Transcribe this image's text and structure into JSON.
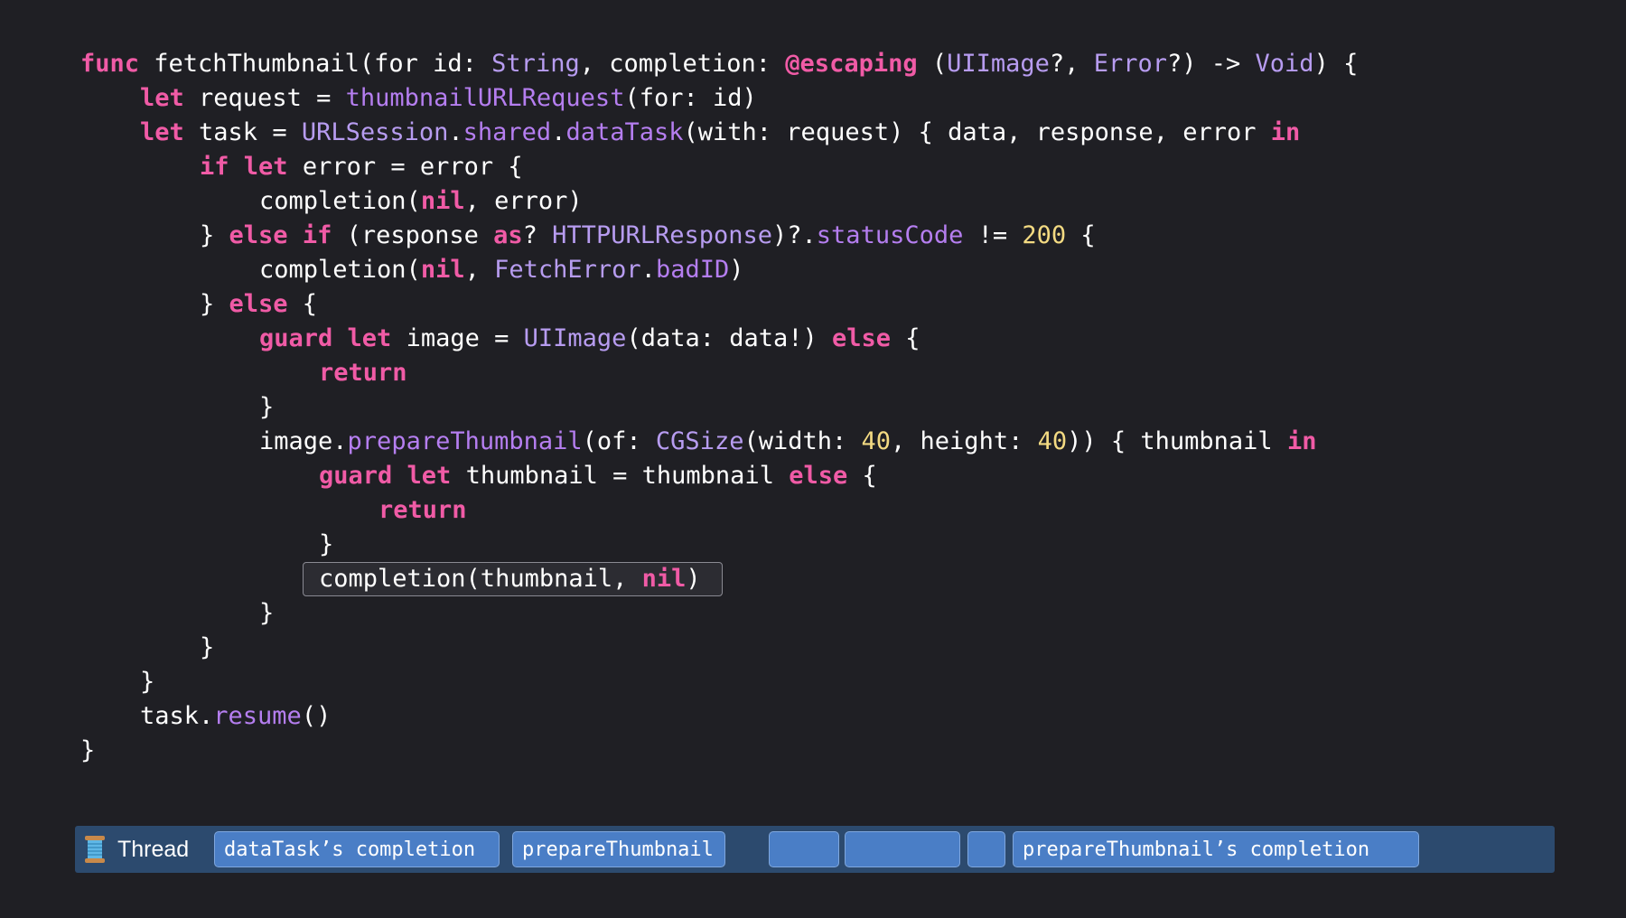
{
  "code": {
    "highlighted_line": 15,
    "lines": [
      {
        "indent": 0,
        "tokens": [
          [
            "kw",
            "func"
          ],
          [
            "p",
            " fetchThumbnail(for id: "
          ],
          [
            "type",
            "String"
          ],
          [
            "p",
            ", completion: "
          ],
          [
            "kw",
            "@escaping"
          ],
          [
            "p",
            " ("
          ],
          [
            "type",
            "UIImage"
          ],
          [
            "p",
            "?, "
          ],
          [
            "type",
            "Error"
          ],
          [
            "p",
            "?) -> "
          ],
          [
            "type",
            "Void"
          ],
          [
            "p",
            ") {"
          ]
        ]
      },
      {
        "indent": 1,
        "tokens": [
          [
            "kw",
            "let"
          ],
          [
            "p",
            " request = "
          ],
          [
            "fn",
            "thumbnailURLRequest"
          ],
          [
            "p",
            "(for: id)"
          ]
        ]
      },
      {
        "indent": 1,
        "tokens": [
          [
            "kw",
            "let"
          ],
          [
            "p",
            " task = "
          ],
          [
            "type",
            "URLSession"
          ],
          [
            "p",
            "."
          ],
          [
            "fn",
            "shared"
          ],
          [
            "p",
            "."
          ],
          [
            "fn",
            "dataTask"
          ],
          [
            "p",
            "(with: request) { data, response, error "
          ],
          [
            "kw",
            "in"
          ]
        ]
      },
      {
        "indent": 2,
        "tokens": [
          [
            "kw",
            "if"
          ],
          [
            "p",
            " "
          ],
          [
            "kw",
            "let"
          ],
          [
            "p",
            " error = error {"
          ]
        ]
      },
      {
        "indent": 3,
        "tokens": [
          [
            "p",
            "completion("
          ],
          [
            "kw",
            "nil"
          ],
          [
            "p",
            ", error)"
          ]
        ]
      },
      {
        "indent": 2,
        "tokens": [
          [
            "p",
            "} "
          ],
          [
            "kw",
            "else"
          ],
          [
            "p",
            " "
          ],
          [
            "kw",
            "if"
          ],
          [
            "p",
            " (response "
          ],
          [
            "kw",
            "as"
          ],
          [
            "p",
            "? "
          ],
          [
            "type",
            "HTTPURLResponse"
          ],
          [
            "p",
            ")?."
          ],
          [
            "fn",
            "statusCode"
          ],
          [
            "p",
            " != "
          ],
          [
            "num",
            "200"
          ],
          [
            "p",
            " {"
          ]
        ]
      },
      {
        "indent": 3,
        "tokens": [
          [
            "p",
            "completion("
          ],
          [
            "kw",
            "nil"
          ],
          [
            "p",
            ", "
          ],
          [
            "type",
            "FetchError"
          ],
          [
            "p",
            "."
          ],
          [
            "fn",
            "badID"
          ],
          [
            "p",
            ")"
          ]
        ]
      },
      {
        "indent": 2,
        "tokens": [
          [
            "p",
            "} "
          ],
          [
            "kw",
            "else"
          ],
          [
            "p",
            " {"
          ]
        ]
      },
      {
        "indent": 3,
        "tokens": [
          [
            "kw",
            "guard"
          ],
          [
            "p",
            " "
          ],
          [
            "kw",
            "let"
          ],
          [
            "p",
            " image = "
          ],
          [
            "type",
            "UIImage"
          ],
          [
            "p",
            "(data: data!) "
          ],
          [
            "kw",
            "else"
          ],
          [
            "p",
            " {"
          ]
        ]
      },
      {
        "indent": 4,
        "tokens": [
          [
            "kw",
            "return"
          ]
        ]
      },
      {
        "indent": 3,
        "tokens": [
          [
            "p",
            "}"
          ]
        ]
      },
      {
        "indent": 3,
        "tokens": [
          [
            "p",
            "image."
          ],
          [
            "fn",
            "prepareThumbnail"
          ],
          [
            "p",
            "(of: "
          ],
          [
            "type",
            "CGSize"
          ],
          [
            "p",
            "(width: "
          ],
          [
            "num",
            "40"
          ],
          [
            "p",
            ", height: "
          ],
          [
            "num",
            "40"
          ],
          [
            "p",
            ")) { thumbnail "
          ],
          [
            "kw",
            "in"
          ]
        ]
      },
      {
        "indent": 4,
        "tokens": [
          [
            "kw",
            "guard"
          ],
          [
            "p",
            " "
          ],
          [
            "kw",
            "let"
          ],
          [
            "p",
            " thumbnail = thumbnail "
          ],
          [
            "kw",
            "else"
          ],
          [
            "p",
            " {"
          ]
        ]
      },
      {
        "indent": 5,
        "tokens": [
          [
            "kw",
            "return"
          ]
        ]
      },
      {
        "indent": 4,
        "tokens": [
          [
            "p",
            "}"
          ]
        ]
      },
      {
        "indent": 4,
        "tokens": [
          [
            "p",
            "completion(thumbnail, "
          ],
          [
            "kw",
            "nil"
          ],
          [
            "p",
            ")"
          ]
        ]
      },
      {
        "indent": 3,
        "tokens": [
          [
            "p",
            "}"
          ]
        ]
      },
      {
        "indent": 2,
        "tokens": [
          [
            "p",
            "}"
          ]
        ]
      },
      {
        "indent": 1,
        "tokens": [
          [
            "p",
            "}"
          ]
        ]
      },
      {
        "indent": 1,
        "tokens": [
          [
            "p",
            "task."
          ],
          [
            "fn",
            "resume"
          ],
          [
            "p",
            "()"
          ]
        ]
      },
      {
        "indent": 0,
        "tokens": [
          [
            "p",
            "}"
          ]
        ]
      }
    ]
  },
  "thread_bar": {
    "label": "Thread",
    "icon": "spool-of-thread-icon",
    "segments": [
      {
        "label": "dataTask’s completion"
      },
      {
        "label": "prepareThumbnail"
      },
      {
        "label": ""
      },
      {
        "label": ""
      },
      {
        "label": ""
      },
      {
        "label": "prepareThumbnail’s completion"
      }
    ]
  },
  "colors": {
    "background": "#1f1f24",
    "keyword": "#f05ba6",
    "type": "#b79cf0",
    "function": "#b57ef0",
    "number": "#f3da82",
    "plain": "#ffffff",
    "thread_bar": "#2c4a6e",
    "segment": "#4a7ec6"
  }
}
